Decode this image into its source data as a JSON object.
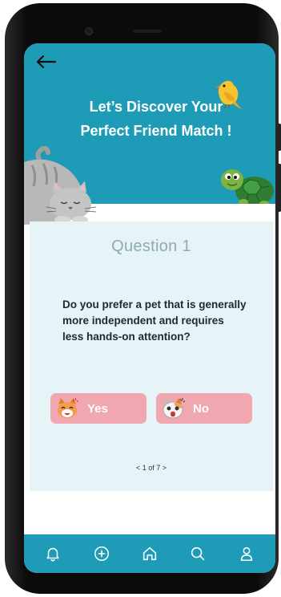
{
  "header": {
    "title_line1": "Let’s Discover Your",
    "title_line2": "Perfect Friend Match !"
  },
  "question": {
    "label": "Question 1",
    "text": "Do you prefer a pet that is generally more independent and requires less hands-on attention?"
  },
  "answers": {
    "yes_label": "Yes",
    "no_label": "No"
  },
  "pagination": {
    "prev": "<",
    "current_text": "1 of 7",
    "next": ">"
  },
  "nav": {
    "items": [
      "bell-icon",
      "plus-circle-icon",
      "home-icon",
      "search-icon",
      "user-icon"
    ]
  },
  "colors": {
    "primary": "#1e9bb6",
    "card_bg": "#e6f3f7",
    "answer_bg": "#f0a7af",
    "question_label": "#8eaab5"
  }
}
